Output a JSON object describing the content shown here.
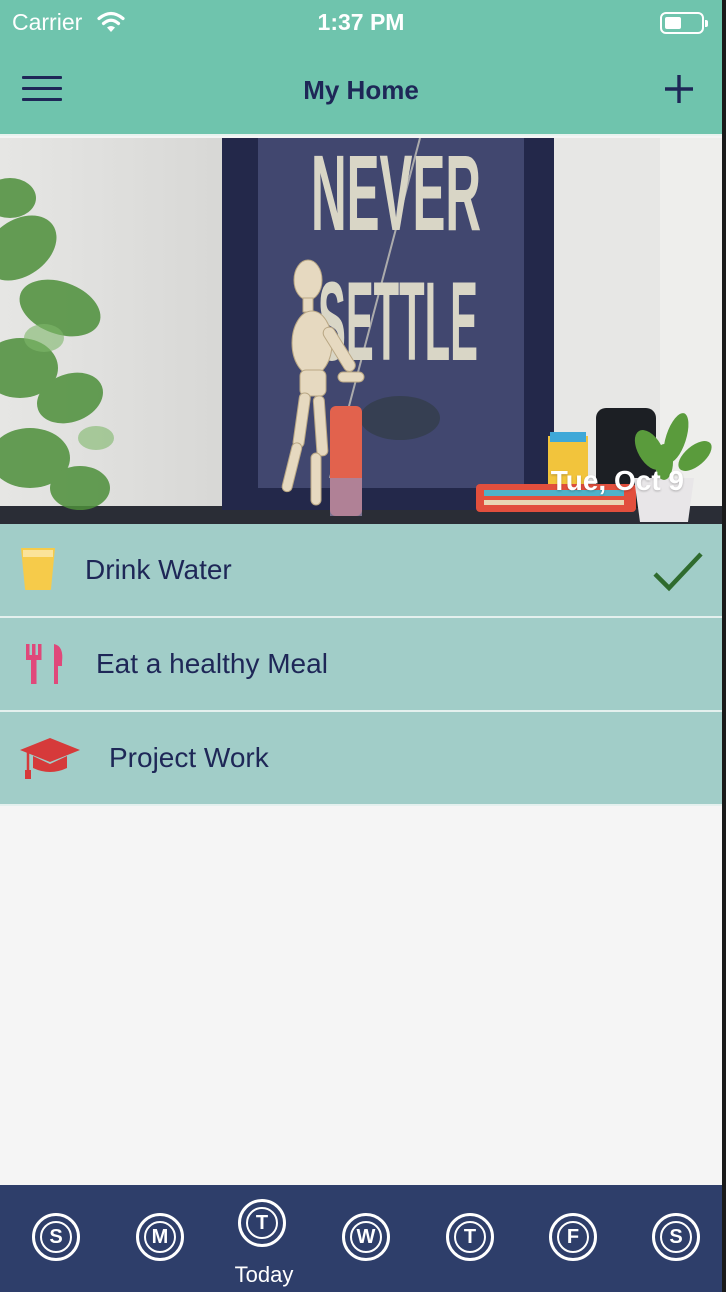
{
  "status_bar": {
    "carrier": "Carrier",
    "time": "1:37 PM"
  },
  "nav": {
    "title": "My Home"
  },
  "hero": {
    "date": "Tue, Oct 9",
    "poster_text_line1": "NEVER",
    "poster_text_line2": "SETTLE"
  },
  "tasks": [
    {
      "label": "Drink Water",
      "icon": "water-glass-icon",
      "completed": true
    },
    {
      "label": "Eat a healthy Meal",
      "icon": "fork-knife-icon",
      "completed": false
    },
    {
      "label": "Project Work",
      "icon": "graduation-cap-icon",
      "completed": false
    }
  ],
  "days": [
    {
      "letter": "S"
    },
    {
      "letter": "M"
    },
    {
      "letter": "T",
      "caption": "Today"
    },
    {
      "letter": "W"
    },
    {
      "letter": "T"
    },
    {
      "letter": "F"
    },
    {
      "letter": "S"
    }
  ],
  "colors": {
    "header": "#6fc4ad",
    "task_row": "#a1cdc8",
    "text_dark": "#1e2757",
    "tab_bar": "#2e3e6a",
    "check": "#2f6b2e",
    "water_icon": "#f6cb4a",
    "meal_icon": "#e0487a",
    "cap_icon": "#d63a3a"
  }
}
